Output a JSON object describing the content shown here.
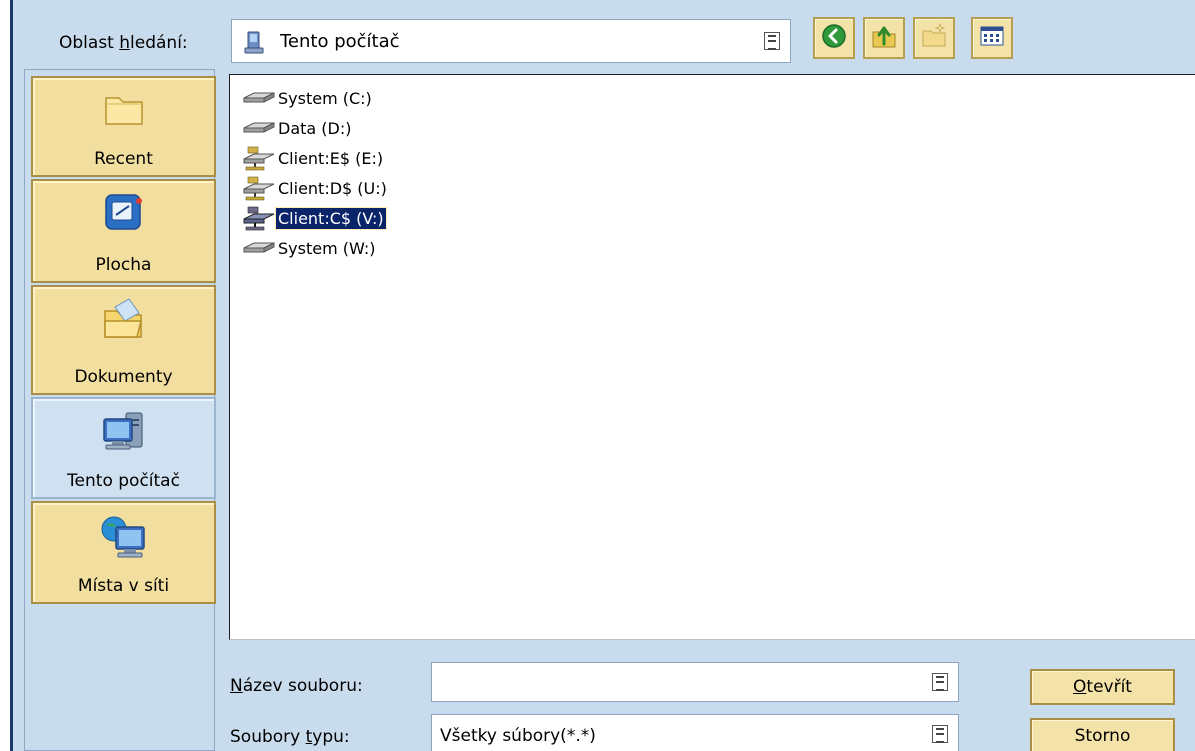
{
  "lookin": {
    "label_before": "Oblast ",
    "label_underlined": "h",
    "label_after": "ledání:",
    "value": "Tento počítač"
  },
  "toolbar": {
    "icons": [
      "back-icon",
      "up-folder-icon",
      "new-folder-icon",
      "view-menu-icon"
    ]
  },
  "places": [
    {
      "label": "Recent",
      "icon": "recent-folder-icon"
    },
    {
      "label": "Plocha",
      "icon": "desktop-icon"
    },
    {
      "label": "Dokumenty",
      "icon": "documents-folder-icon"
    },
    {
      "label": "Tento počítač",
      "icon": "my-computer-icon",
      "active": true
    },
    {
      "label": "Místa v síti",
      "icon": "network-places-icon"
    }
  ],
  "files": [
    {
      "label": "System (C:)",
      "icon": "hard-drive-icon"
    },
    {
      "label": "Data (D:)",
      "icon": "hard-drive-icon"
    },
    {
      "label": "Client:E$ (E:)",
      "icon": "network-drive-icon"
    },
    {
      "label": "Client:D$ (U:)",
      "icon": "network-drive-icon"
    },
    {
      "label": "Client:C$ (V:)",
      "icon": "network-drive-icon",
      "selected": true
    },
    {
      "label": "System (W:)",
      "icon": "hard-drive-icon"
    }
  ],
  "filename": {
    "label_underlined": "N",
    "label_rest": "ázev souboru:",
    "value": ""
  },
  "filetype": {
    "label_before": "Soubory ",
    "label_underlined": "t",
    "label_after": "ypu:",
    "value": "Všetky súbory(*.*)"
  },
  "buttons": {
    "open_underlined": "O",
    "open_rest": "tevřít",
    "cancel": "Storno"
  },
  "colors": {
    "dialog_bg": "#c9dced",
    "button_bg": "#f4e3a8",
    "selection": "#0a246a"
  }
}
